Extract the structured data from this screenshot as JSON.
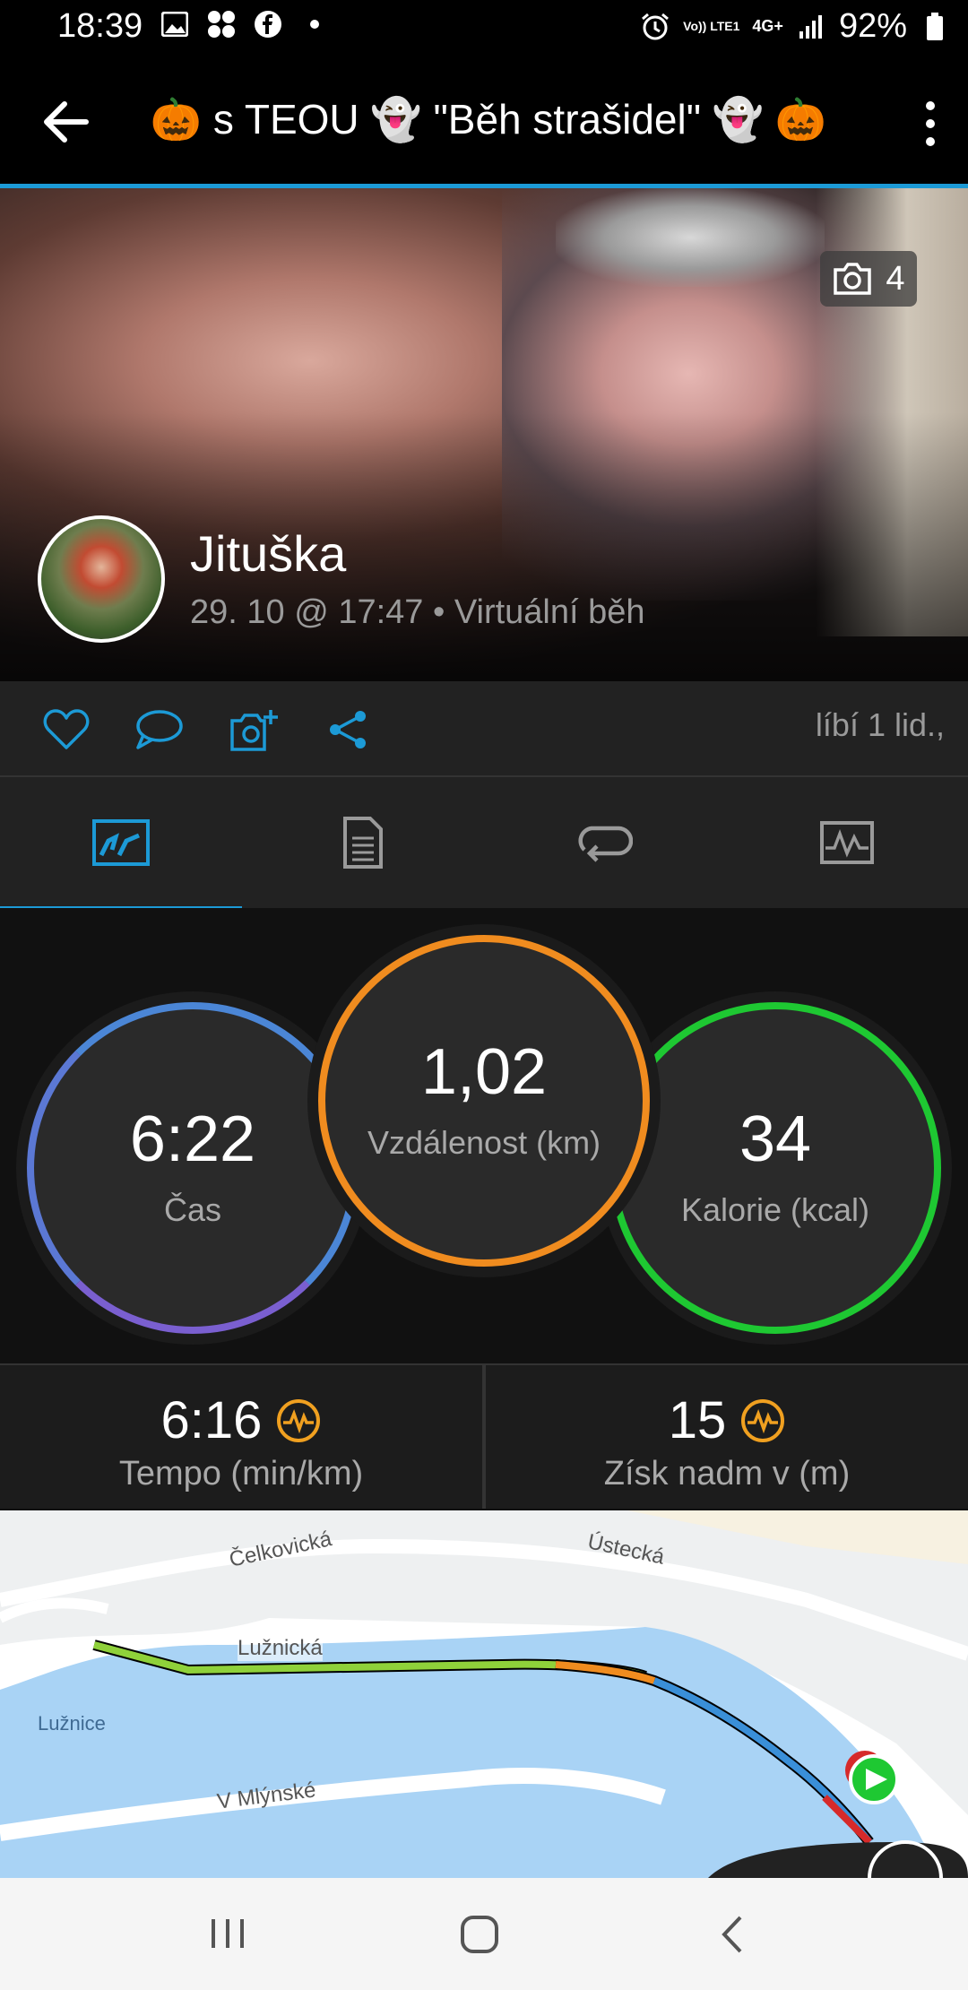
{
  "status_bar": {
    "time": "18:39",
    "battery": "92%",
    "network": "4G+",
    "carrier_tag": "Vo)) LTE1"
  },
  "app_bar": {
    "title": "🎃 s TEOU 👻 \"Běh strašidel\" 👻 🎃"
  },
  "hero": {
    "photo_count": "4",
    "user_name": "Jituška",
    "subtitle": "29. 10 @ 17:47 • Virtuální běh"
  },
  "actions": {
    "likes_text": "líbí 1 lid.,"
  },
  "tabs": [
    {
      "name": "overview",
      "icon": "stats-icon",
      "active": true
    },
    {
      "name": "details",
      "icon": "document-icon",
      "active": false
    },
    {
      "name": "laps",
      "icon": "loop-icon",
      "active": false
    },
    {
      "name": "charts",
      "icon": "chart-icon",
      "active": false
    }
  ],
  "rings": {
    "time": {
      "value": "6:22",
      "label": "Čas",
      "color": "#3a8fd8"
    },
    "distance": {
      "value": "1,02",
      "label": "Vzdálenost (km)",
      "color": "#f08c1f"
    },
    "calories": {
      "value": "34",
      "label": "Kalorie (kcal)",
      "color": "#1ec832"
    }
  },
  "metrics": {
    "pace": {
      "value": "6:16",
      "label": "Tempo (min/km)"
    },
    "elevation": {
      "value": "15",
      "label": "Získ nadm v (m)"
    }
  },
  "map": {
    "labels": {
      "celkovicka": "Čelkovická",
      "ustecka": "Ústecká",
      "luznicka": "Lužnická",
      "luznice": "Lužnice",
      "v_mlynske": "V Mlýnské"
    }
  },
  "colors": {
    "accent": "#1c9ad6",
    "highlight": "#f0a020"
  }
}
